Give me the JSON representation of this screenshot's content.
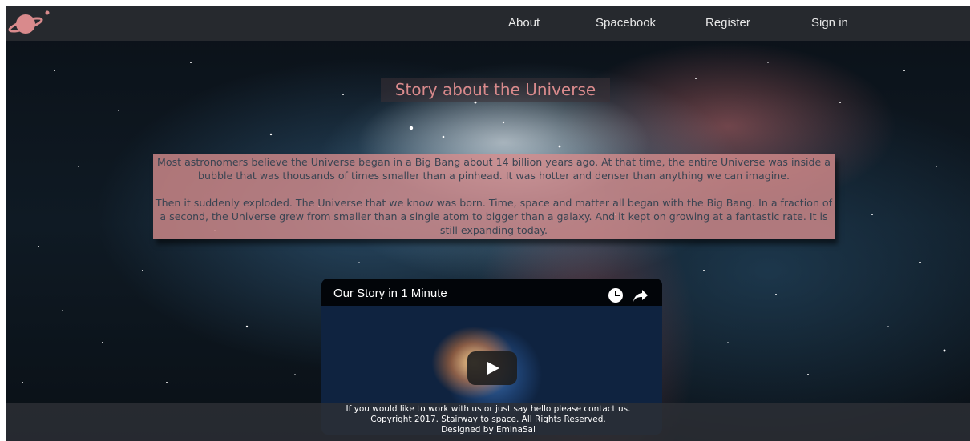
{
  "nav": {
    "items": [
      {
        "label": "About"
      },
      {
        "label": "Spacebook"
      },
      {
        "label": "Register"
      },
      {
        "label": "Sign in"
      }
    ]
  },
  "logo": {
    "icon": "planet-logo-icon",
    "color": "#d98a8c"
  },
  "hero": {
    "title": "Story about the Universe",
    "paragraph_1": "Most astronomers believe the Universe began in a Big Bang about 14 billion years ago. At that time, the entire Universe was inside a bubble that was thousands of times smaller than a pinhead. It was hotter and denser than anything we can imagine.",
    "paragraph_2": "Then it suddenly exploded. The Universe that we know was born. Time, space and matter all began with the Big Bang. In a fraction of a second, the Universe grew from smaller than a single atom to bigger than a galaxy. And it kept on growing at a fantastic rate. It is still expanding today."
  },
  "video": {
    "title": "Our Story in 1 Minute",
    "icons": [
      "clock-icon",
      "share-icon",
      "play-icon"
    ]
  },
  "footer": {
    "line_1": "If you would like to work with us or just say hello please contact us.",
    "line_2": "Copyright 2017. Stairway to space. All Rights Reserved.",
    "line_3": "Designed by EminaSal"
  },
  "colors": {
    "accent": "#d98a8c",
    "navbar": "#26292e",
    "story_bg": "#d68c8c"
  }
}
